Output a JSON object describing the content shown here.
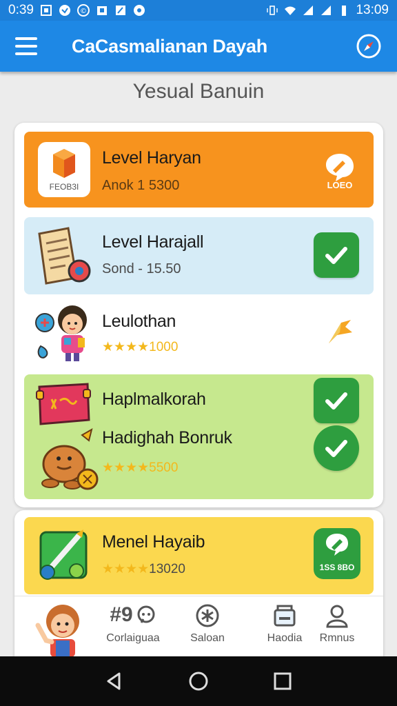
{
  "status_bar": {
    "time_left": "0:39",
    "time_right": "13:09"
  },
  "app_bar": {
    "title": "CaCasmalianan Dayah"
  },
  "section": {
    "title": "Yesual Banuin"
  },
  "rows": [
    {
      "title": "Level Haryan",
      "subtitle": "Anok 1 5300",
      "thumb_text": "FEOB3I",
      "badge_text": "LOEO",
      "color": "#f7931e"
    },
    {
      "title": "Level Harajall",
      "subtitle": "Sond - 15.50",
      "color": "#d6ecf7"
    },
    {
      "title": "Leulothan",
      "stars": "★★★★",
      "points": "1000",
      "color": "#ffffff"
    },
    {
      "title": "Haplmalkorah",
      "color": "#c6e88e"
    },
    {
      "title": "Hadighah Bonruk",
      "stars": "★★★★",
      "points": "5500",
      "color": "#c6e88e"
    },
    {
      "title": "Menel Hayaib",
      "stars": "★★★★",
      "points": "13020",
      "badge_text": "1SS 8BO",
      "color": "#fbd84f"
    }
  ],
  "bottom_nav": {
    "items": [
      {
        "label": "Corlaiguaa",
        "icon": "hash-chat-icon"
      },
      {
        "label": "Saloan",
        "icon": "asterisk-circle-icon"
      },
      {
        "label": "Haodia",
        "icon": "wallet-icon"
      },
      {
        "label": "Rmnus",
        "icon": "user-icon"
      }
    ],
    "hash_text": "#9"
  },
  "colors": {
    "primary": "#1e88e5",
    "status_bar": "#1d7fd8",
    "check_green": "#2e9e3f",
    "orange": "#f7931e",
    "light_blue": "#d6ecf7",
    "light_green": "#c6e88e",
    "yellow": "#fbd84f",
    "star": "#f3b81c"
  }
}
